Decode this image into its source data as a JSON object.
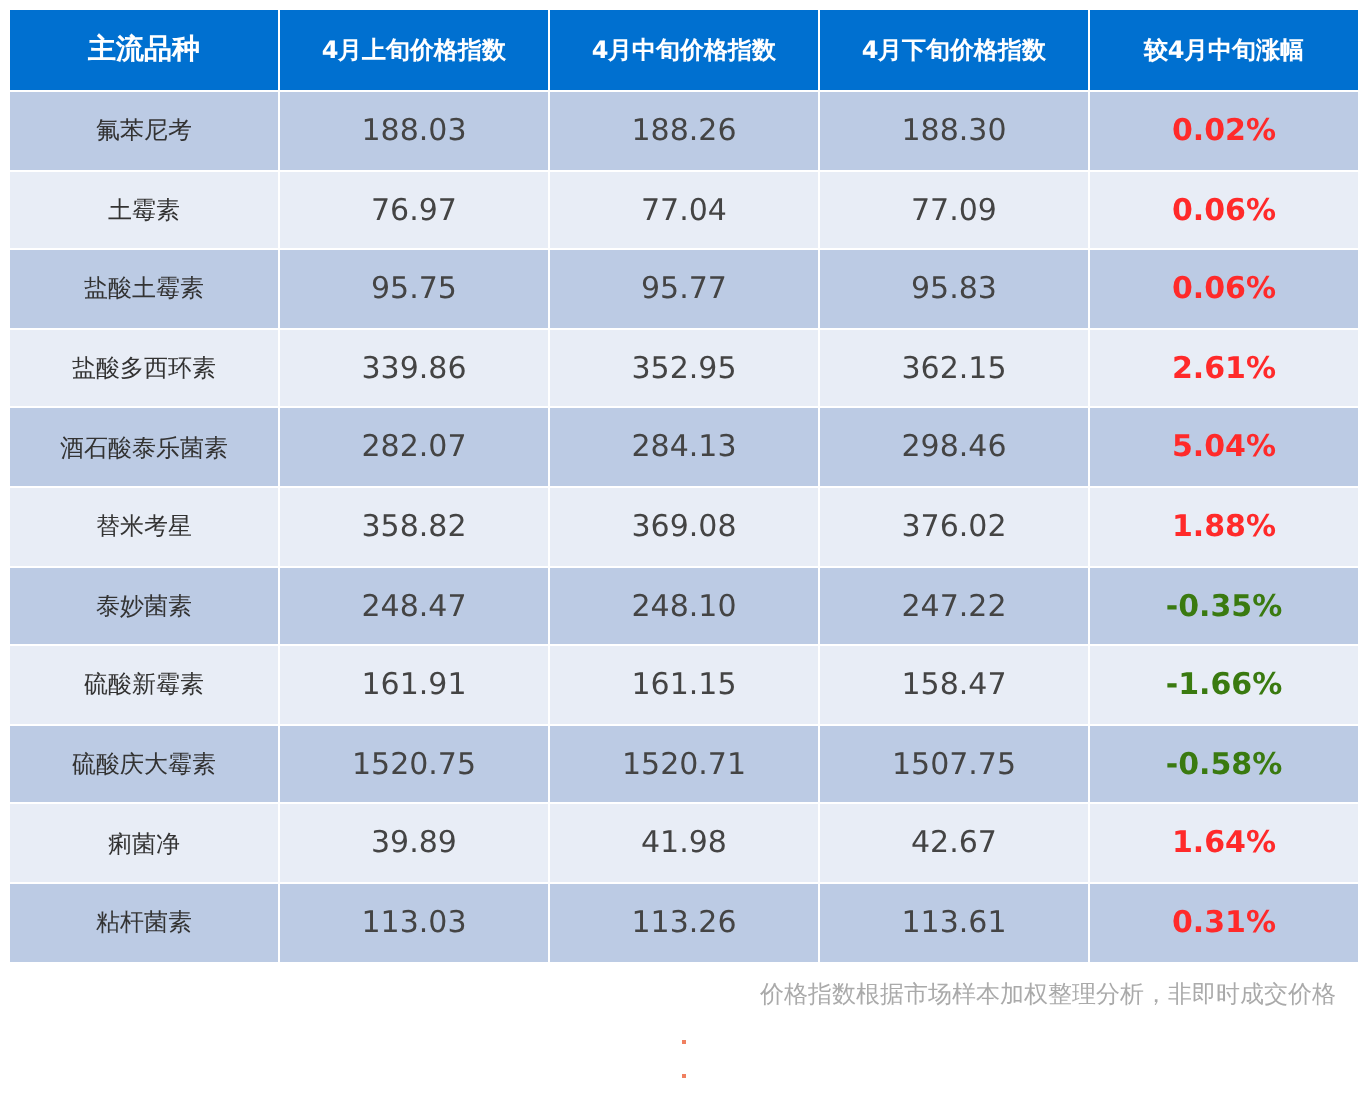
{
  "table": {
    "columns": [
      "主流品种",
      "4月上旬价格指数",
      "4月中旬价格指数",
      "4月下旬价格指数",
      "较4月中旬涨幅"
    ],
    "rows": [
      {
        "name": "氟苯尼考",
        "values": [
          "188.03",
          "188.26",
          "188.30"
        ],
        "change": "0.02%",
        "color": "#ff2a2a"
      },
      {
        "name": "土霉素",
        "values": [
          "76.97",
          "77.04",
          "77.09"
        ],
        "change": "0.06%",
        "color": "#ff2a2a"
      },
      {
        "name": "盐酸土霉素",
        "values": [
          "95.75",
          "95.77",
          "95.83"
        ],
        "change": "0.06%",
        "color": "#ff2a2a"
      },
      {
        "name": "盐酸多西环素",
        "values": [
          "339.86",
          "352.95",
          "362.15"
        ],
        "change": "2.61%",
        "color": "#ff2a2a"
      },
      {
        "name": "酒石酸泰乐菌素",
        "values": [
          "282.07",
          "284.13",
          "298.46"
        ],
        "change": "5.04%",
        "color": "#ff2a2a"
      },
      {
        "name": "替米考星",
        "values": [
          "358.82",
          "369.08",
          "376.02"
        ],
        "change": "1.88%",
        "color": "#ff2a2a"
      },
      {
        "name": "泰妙菌素",
        "values": [
          "248.47",
          "248.10",
          "247.22"
        ],
        "change": "-0.35%",
        "color": "#3a7a10"
      },
      {
        "name": "硫酸新霉素",
        "values": [
          "161.91",
          "161.15",
          "158.47"
        ],
        "change": "-1.66%",
        "color": "#3a7a10"
      },
      {
        "name": "硫酸庆大霉素",
        "values": [
          "1520.75",
          "1520.71",
          "1507.75"
        ],
        "change": "-0.58%",
        "color": "#3a7a10"
      },
      {
        "name": "痢菌净",
        "values": [
          "39.89",
          "41.98",
          "42.67"
        ],
        "change": "1.64%",
        "color": "#ff2a2a"
      },
      {
        "name": "粘杆菌素",
        "values": [
          "113.03",
          "113.26",
          "113.61"
        ],
        "change": "0.31%",
        "color": "#ff2a2a"
      }
    ]
  },
  "note": "价格指数根据市场样本加权整理分析，非即时成交价格"
}
